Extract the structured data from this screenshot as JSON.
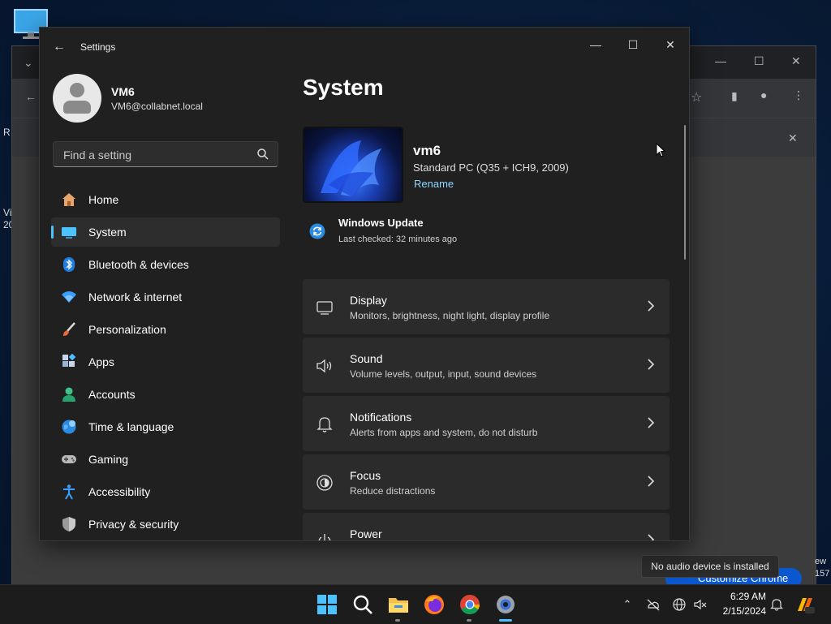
{
  "desktop": {
    "left_fragments": [
      "R",
      "Vi",
      "20"
    ],
    "right_fragments": [
      "ew",
      "157"
    ]
  },
  "chrome": {
    "customize_label": "Customize Chrome",
    "tooltip": "No audio device is installed"
  },
  "window": {
    "title": "Settings",
    "back_glyph": "←",
    "minimize_glyph": "—",
    "maximize_glyph": "☐",
    "close_glyph": "✕"
  },
  "user": {
    "name": "VM6",
    "email": "VM6@collabnet.local"
  },
  "search": {
    "placeholder": "Find a setting"
  },
  "nav": {
    "items": [
      {
        "label": "Home",
        "icon": "home-icon"
      },
      {
        "label": "System",
        "icon": "system-icon",
        "active": true
      },
      {
        "label": "Bluetooth & devices",
        "icon": "bluetooth-icon"
      },
      {
        "label": "Network & internet",
        "icon": "wifi-icon"
      },
      {
        "label": "Personalization",
        "icon": "brush-icon"
      },
      {
        "label": "Apps",
        "icon": "apps-icon"
      },
      {
        "label": "Accounts",
        "icon": "accounts-icon"
      },
      {
        "label": "Time & language",
        "icon": "globe-icon"
      },
      {
        "label": "Gaming",
        "icon": "gamepad-icon"
      },
      {
        "label": "Accessibility",
        "icon": "accessibility-icon"
      },
      {
        "label": "Privacy & security",
        "icon": "shield-icon"
      }
    ]
  },
  "main": {
    "title": "System",
    "device": {
      "name": "vm6",
      "model": "Standard PC (Q35 + ICH9, 2009)",
      "rename": "Rename"
    },
    "windows_update": {
      "title": "Windows Update",
      "subtitle": "Last checked: 32 minutes ago"
    },
    "cards": [
      {
        "title": "Display",
        "subtitle": "Monitors, brightness, night light, display profile",
        "icon": "display-icon"
      },
      {
        "title": "Sound",
        "subtitle": "Volume levels, output, input, sound devices",
        "icon": "speaker-icon"
      },
      {
        "title": "Notifications",
        "subtitle": "Alerts from apps and system, do not disturb",
        "icon": "bell-icon"
      },
      {
        "title": "Focus",
        "subtitle": "Reduce distractions",
        "icon": "focus-icon"
      },
      {
        "title": "Power",
        "subtitle": "",
        "icon": "power-icon"
      }
    ]
  },
  "taskbar": {
    "time": "6:29 AM",
    "date": "2/15/2024",
    "accent": "#4cc2ff"
  }
}
